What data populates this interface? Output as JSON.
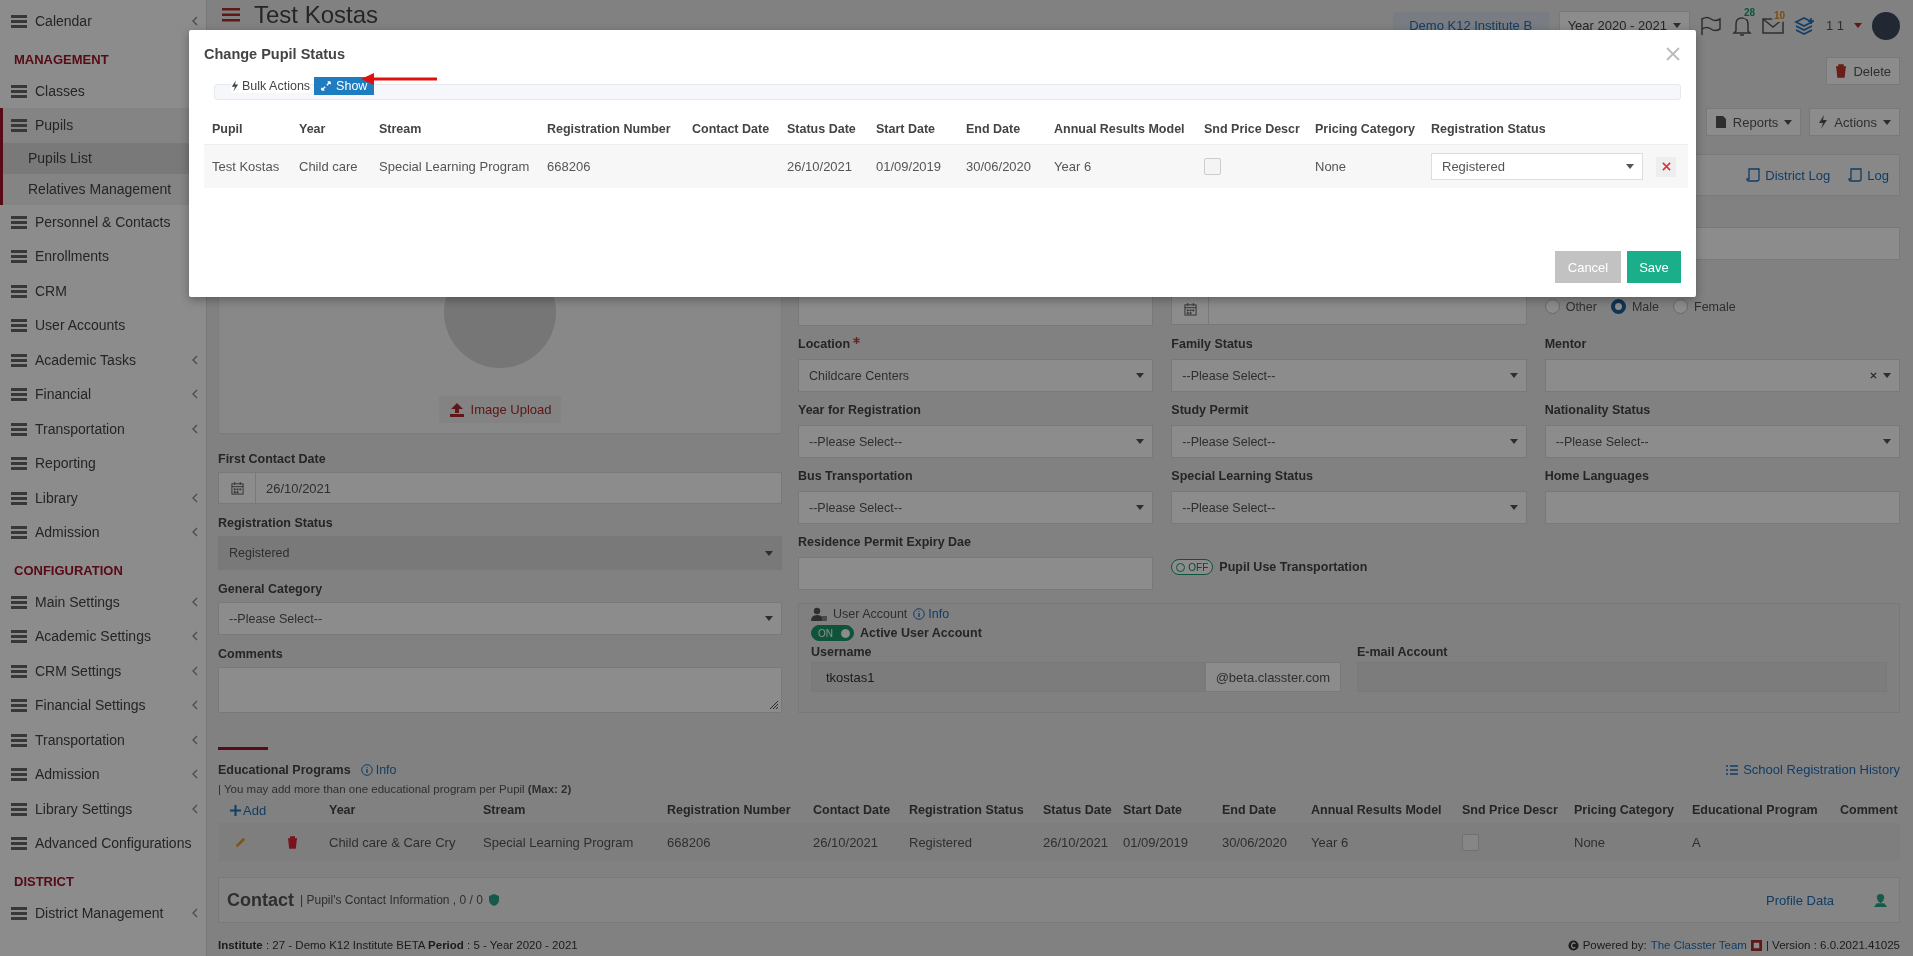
{
  "header": {
    "title": "Test Kostas",
    "institute": "Demo K12 Institute B",
    "year": "Year 2020 - 2021",
    "notifications": "28",
    "messages": "10",
    "user": "1 1"
  },
  "sidebar": {
    "items": [
      {
        "kind": "item",
        "label": "Calendar",
        "expandable": true,
        "expanded": false,
        "selected": false
      },
      {
        "kind": "section",
        "label": "MANAGEMENT"
      },
      {
        "kind": "item",
        "label": "Classes",
        "expanded": false,
        "selected": false
      },
      {
        "kind": "item",
        "label": "Pupils",
        "expanded": true,
        "selected": false,
        "children": [
          {
            "label": "Pupils List",
            "selected": true
          },
          {
            "label": "Relatives Management",
            "selected": false
          }
        ]
      },
      {
        "kind": "item",
        "label": "Personnel & Contacts",
        "expanded": false,
        "selected": false
      },
      {
        "kind": "item",
        "label": "Enrollments",
        "expanded": false,
        "selected": false
      },
      {
        "kind": "item",
        "label": "CRM",
        "expanded": false,
        "selected": false
      },
      {
        "kind": "item",
        "label": "User Accounts",
        "expandable": false,
        "expanded": false,
        "selected": false
      },
      {
        "kind": "item",
        "label": "Academic Tasks",
        "expandable": true,
        "expanded": false,
        "selected": false
      },
      {
        "kind": "item",
        "label": "Financial",
        "expandable": true,
        "expanded": false,
        "selected": false
      },
      {
        "kind": "item",
        "label": "Transportation",
        "expandable": true,
        "expanded": false,
        "selected": false
      },
      {
        "kind": "item",
        "label": "Reporting",
        "expandable": false,
        "expanded": false,
        "selected": false
      },
      {
        "kind": "item",
        "label": "Library",
        "expandable": true,
        "expanded": false,
        "selected": false
      },
      {
        "kind": "item",
        "label": "Admission",
        "expandable": true,
        "expanded": false,
        "selected": false
      },
      {
        "kind": "section",
        "label": "CONFIGURATION"
      },
      {
        "kind": "item",
        "label": "Main Settings",
        "expandable": true,
        "expanded": false,
        "selected": false
      },
      {
        "kind": "item",
        "label": "Academic Settings",
        "expandable": true,
        "expanded": false,
        "selected": false
      },
      {
        "kind": "item",
        "label": "CRM Settings",
        "expandable": true,
        "expanded": false,
        "selected": false
      },
      {
        "kind": "item",
        "label": "Financial Settings",
        "expandable": true,
        "expanded": false,
        "selected": false
      },
      {
        "kind": "item",
        "label": "Transportation",
        "expandable": true,
        "expanded": false,
        "selected": false
      },
      {
        "kind": "item",
        "label": "Admission",
        "expandable": true,
        "expanded": false,
        "selected": false
      },
      {
        "kind": "item",
        "label": "Library Settings",
        "expandable": true,
        "expanded": false,
        "selected": false
      },
      {
        "kind": "item",
        "label": "Advanced Configurations",
        "expandable": false,
        "expanded": false,
        "selected": false
      },
      {
        "kind": "section",
        "label": "DISTRICT"
      },
      {
        "kind": "item",
        "label": "District Management",
        "expandable": true,
        "expanded": false,
        "selected": false
      }
    ]
  },
  "toolbar": {
    "delete": "Delete",
    "reports": "Reports",
    "actions": "Actions",
    "district_log": "District Log",
    "log": "Log"
  },
  "photo": {
    "upload": "Image Upload"
  },
  "left_fields": [
    {
      "kind": "date",
      "label": "First Contact Date",
      "value": "26/10/2021"
    },
    {
      "kind": "select",
      "label": "Registration Status",
      "value": "Registered",
      "disabled": true
    },
    {
      "kind": "select",
      "label": "General Category",
      "value": "--Please Select--",
      "disabled": false
    },
    {
      "kind": "textarea",
      "label": "Comments"
    }
  ],
  "fields": [
    {
      "kind": "blank"
    },
    {
      "kind": "blank"
    },
    {
      "kind": "input"
    },
    {
      "kind": "input"
    },
    {
      "kind": "date"
    },
    {
      "kind": "radios",
      "options": [
        {
          "label": "Other",
          "selected": false
        },
        {
          "label": "Male",
          "selected": true
        },
        {
          "label": "Female",
          "selected": false
        }
      ]
    },
    {
      "kind": "select",
      "label": "Location",
      "required": true,
      "value": "Childcare Centers"
    },
    {
      "kind": "select",
      "label": "Family Status",
      "value": "--Please Select--"
    },
    {
      "kind": "select",
      "label": "Mentor",
      "clearable": true
    },
    {
      "kind": "select",
      "label": "Year for Registration",
      "value": "--Please Select--"
    },
    {
      "kind": "select",
      "label": "Study Permit",
      "value": "--Please Select--"
    },
    {
      "kind": "select",
      "label": "Nationality Status",
      "value": "--Please Select--"
    },
    {
      "kind": "select",
      "label": "Bus Transportation",
      "value": "--Please Select--"
    },
    {
      "kind": "select",
      "label": "Special Learning Status",
      "value": "--Please Select--"
    },
    {
      "kind": "input",
      "label": "Home Languages"
    },
    {
      "kind": "input",
      "label": "Residence Permit Expiry Dae"
    },
    {
      "kind": "toggle",
      "label": "Pupil Use Transportation",
      "on": false,
      "text": "OFF"
    },
    {
      "kind": "blank"
    }
  ],
  "user_account": {
    "title": "User Account",
    "info": "Info",
    "active": {
      "label": "Active User Account",
      "on": true,
      "text": "ON"
    },
    "username": {
      "label": "Username",
      "value": "tkostas1",
      "suffix": "@beta.classter.com"
    },
    "email": {
      "label": "E-mail Account"
    }
  },
  "programs": {
    "title": "Educational Programs",
    "info": "Info",
    "note": "| You may add more than one educational program per Pupil **(Max: 2)**",
    "history": "School Registration History",
    "add": "Add",
    "columns": [
      "Year",
      "Stream",
      "Registration Number",
      "Contact Date",
      "Registration Status",
      "Status Date",
      "Start Date",
      "End Date",
      "Annual Results Model",
      "Snd Price Descr",
      "Pricing Category",
      "Educational Program",
      "Comment"
    ],
    "rows": [
      {
        "cells": [
          {
            "kind": "text",
            "text": "Child care & Care Cry"
          },
          {
            "kind": "text",
            "text": "Special Learning Program"
          },
          {
            "kind": "text",
            "text": "668206"
          },
          {
            "kind": "text",
            "text": "26/10/2021"
          },
          {
            "kind": "text",
            "text": "Registered"
          },
          {
            "kind": "text",
            "text": "26/10/2021"
          },
          {
            "kind": "text",
            "text": "01/09/2019"
          },
          {
            "kind": "text",
            "text": "30/06/2020"
          },
          {
            "kind": "text",
            "text": "Year 6"
          },
          {
            "kind": "checkbox",
            "checked": false
          },
          {
            "kind": "text",
            "text": "None"
          },
          {
            "kind": "text",
            "text": "A"
          },
          {
            "kind": "empty"
          }
        ]
      }
    ]
  },
  "contact": {
    "title": "Contact",
    "subtitle": "| Pupil's Contact Information , 0 / 0",
    "profile": "Profile Data"
  },
  "footer": {
    "info": "**Institute** : 27 - Demo K12 Institute BETA **Period** : 5 - Year 2020 - 2021",
    "powered": "Powered by:",
    "team": "The Classter Team",
    "version": "| Version : 6.0.2021.41025"
  },
  "modal": {
    "title": "Change Pupil Status",
    "bulk": "Bulk Actions",
    "show": "Show",
    "columns": [
      "Pupil",
      "Year",
      "Stream",
      "Registration Number",
      "Contact Date",
      "Status Date",
      "Start Date",
      "End Date",
      "Annual Results Model",
      "Snd Price Descr",
      "Pricing Category",
      "Registration Status"
    ],
    "rows": [
      {
        "cells": [
          {
            "kind": "text",
            "text": "Test Kostas"
          },
          {
            "kind": "text",
            "text": "Child care"
          },
          {
            "kind": "text",
            "text": "Special Learning Program"
          },
          {
            "kind": "text",
            "text": "668206"
          },
          {
            "kind": "empty"
          },
          {
            "kind": "text",
            "text": "26/10/2021"
          },
          {
            "kind": "text",
            "text": "01/09/2019"
          },
          {
            "kind": "text",
            "text": "30/06/2020"
          },
          {
            "kind": "text",
            "text": "Year 6"
          },
          {
            "kind": "checkbox",
            "checked": false
          },
          {
            "kind": "text",
            "text": "None"
          },
          {
            "kind": "select",
            "value": "Registered"
          }
        ]
      }
    ],
    "cancel": "Cancel",
    "save": "Save"
  }
}
